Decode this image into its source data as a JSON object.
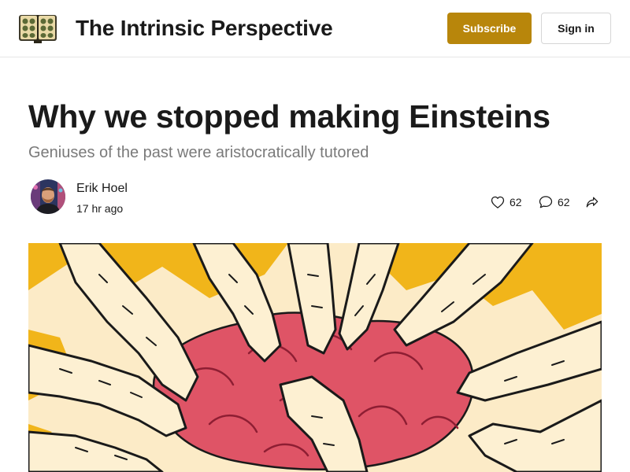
{
  "header": {
    "publication_name": "The Intrinsic Perspective",
    "subscribe_label": "Subscribe",
    "signin_label": "Sign in",
    "logo_icon": "open-book-icon",
    "accent_color": "#b8860b"
  },
  "post": {
    "title": "Why we stopped making Einsteins",
    "subtitle": "Geniuses of the past were aristocratically tutored",
    "author": "Erik Hoel",
    "date": "17 hr ago",
    "likes": "62",
    "comments": "62",
    "icons": {
      "like": "heart-icon",
      "comment": "comment-bubble-icon",
      "share": "share-icon"
    }
  },
  "hero_image": {
    "subject": "illustration-hands-around-brain",
    "colors": {
      "background": "#fcebc7",
      "accent": "#f1b51a",
      "brain": "#df5466",
      "outline": "#1a1a1a"
    }
  }
}
